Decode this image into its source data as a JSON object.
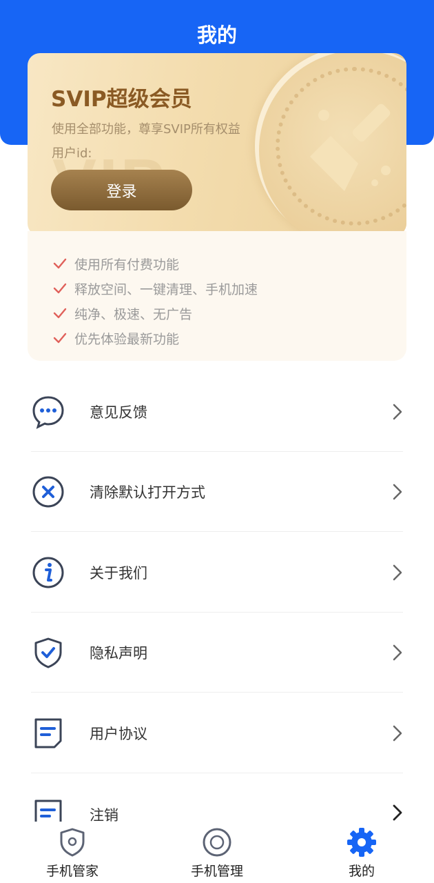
{
  "header": {
    "title": "我的"
  },
  "vip_card": {
    "watermark": "VIP",
    "title": "SVIP超级会员",
    "description": "使用全部功能，尊享SVIP所有权益",
    "user_id_label": "用户id:",
    "login_label": "登录"
  },
  "benefits": [
    "使用所有付费功能",
    "释放空间、一键清理、手机加速",
    "纯净、极速、无广告",
    "优先体验最新功能"
  ],
  "menu": [
    {
      "label": "意见反馈",
      "icon": "chat-bubble-icon"
    },
    {
      "label": "清除默认打开方式",
      "icon": "clear-x-icon"
    },
    {
      "label": "关于我们",
      "icon": "info-icon"
    },
    {
      "label": "隐私声明",
      "icon": "shield-check-icon"
    },
    {
      "label": "用户协议",
      "icon": "document-icon"
    },
    {
      "label": "注销",
      "icon": "document-icon"
    }
  ],
  "tabs": [
    {
      "label": "手机管家",
      "icon": "shield-icon",
      "active": false
    },
    {
      "label": "手机管理",
      "icon": "ring-icon",
      "active": false
    },
    {
      "label": "我的",
      "icon": "gear-icon",
      "active": true
    }
  ],
  "colors": {
    "brand_blue": "#1765f5",
    "gold_dark": "#8a5a24",
    "check_red": "#e0605a",
    "icon_blue": "#1f5fd8"
  }
}
